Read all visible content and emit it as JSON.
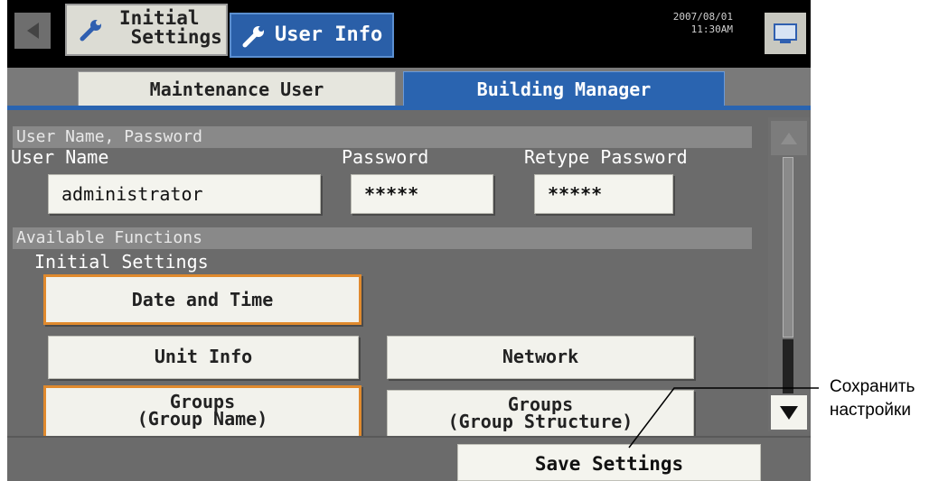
{
  "topbar": {
    "tab_initial_line1": "Initial",
    "tab_initial_line2": "Settings",
    "tab_user_info": "User Info",
    "date": "2007/08/01",
    "time": "11:30AM"
  },
  "subtabs": {
    "maintenance_user": "Maintenance User",
    "building_manager": "Building Manager"
  },
  "credentials": {
    "section_title": "User Name, Password",
    "user_name_label": "User Name",
    "password_label": "Password",
    "retype_password_label": "Retype Password",
    "user_name_value": "administrator",
    "password_value": "*****",
    "retype_password_value": "*****"
  },
  "functions": {
    "section_title": "Available Functions",
    "subsection_title": "Initial Settings",
    "buttons": [
      {
        "line1": "Date and Time",
        "selected": true
      },
      {
        "line1": "Unit Info",
        "selected": false
      },
      {
        "line1": "Network",
        "selected": false
      },
      {
        "line1": "Groups",
        "line2": "(Group Name)",
        "selected": true
      },
      {
        "line1": "Groups",
        "line2": "(Group Structure)",
        "selected": false
      }
    ]
  },
  "footer": {
    "save_settings": "Save Settings"
  },
  "callout": {
    "line1": "Сохранить",
    "line2": "настройки"
  },
  "colors": {
    "accent_blue": "#2a64b0",
    "selected_border": "#e08a2e",
    "panel_gray": "#6b6b6b"
  },
  "icons": [
    "back-arrow-icon",
    "wrench-icon",
    "monitor-icon",
    "scroll-up-icon",
    "scroll-down-icon"
  ]
}
